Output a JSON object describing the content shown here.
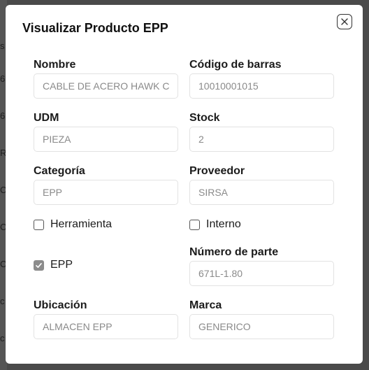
{
  "dialog": {
    "title": "Visualizar Producto EPP"
  },
  "fields": {
    "nombre": {
      "label": "Nombre",
      "value": "CABLE DE ACERO HAWK C"
    },
    "codigo_barras": {
      "label": "Código de barras",
      "value": "10010001015"
    },
    "udm": {
      "label": "UDM",
      "value": "PIEZA"
    },
    "stock": {
      "label": "Stock",
      "value": "2"
    },
    "categoria": {
      "label": "Categoría",
      "value": "EPP"
    },
    "proveedor": {
      "label": "Proveedor",
      "value": "SIRSA"
    },
    "numero_parte": {
      "label": "Número de parte",
      "value": "671L-1.80"
    },
    "ubicacion": {
      "label": "Ubicación",
      "value": "ALMACEN EPP"
    },
    "marca": {
      "label": "Marca",
      "value": "GENERICO"
    }
  },
  "checkboxes": {
    "herramienta": {
      "label": "Herramienta",
      "checked": false
    },
    "interno": {
      "label": "Interno",
      "checked": false
    },
    "epp": {
      "label": "EPP",
      "checked": true
    }
  },
  "background_letters": [
    "s",
    "6",
    "6",
    "R",
    "C",
    "C",
    "C",
    "c",
    "c"
  ],
  "icons": {
    "close": "close-icon",
    "check": "checkmark-icon"
  }
}
